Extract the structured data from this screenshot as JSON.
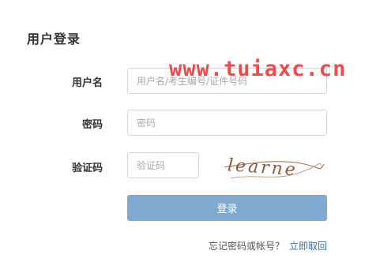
{
  "login": {
    "title": "用户登录",
    "username_label": "用户名",
    "username_placeholder": "用户名/考生编号/证件号码",
    "password_label": "密码",
    "password_placeholder": "密码",
    "captcha_label": "验证码",
    "captcha_placeholder": "验证码",
    "captcha_text": "learne",
    "submit_label": "登录",
    "forgot_text": "忘记密码或帐号？",
    "retrieve_link": "立即取回"
  },
  "watermark": {
    "text": "www.tuiaxc.cn"
  },
  "colors": {
    "button": "#7fa9cf",
    "link": "#2f6fb5",
    "watermark": "#ef3b3b",
    "captcha_ink": "#8b5a3c"
  }
}
